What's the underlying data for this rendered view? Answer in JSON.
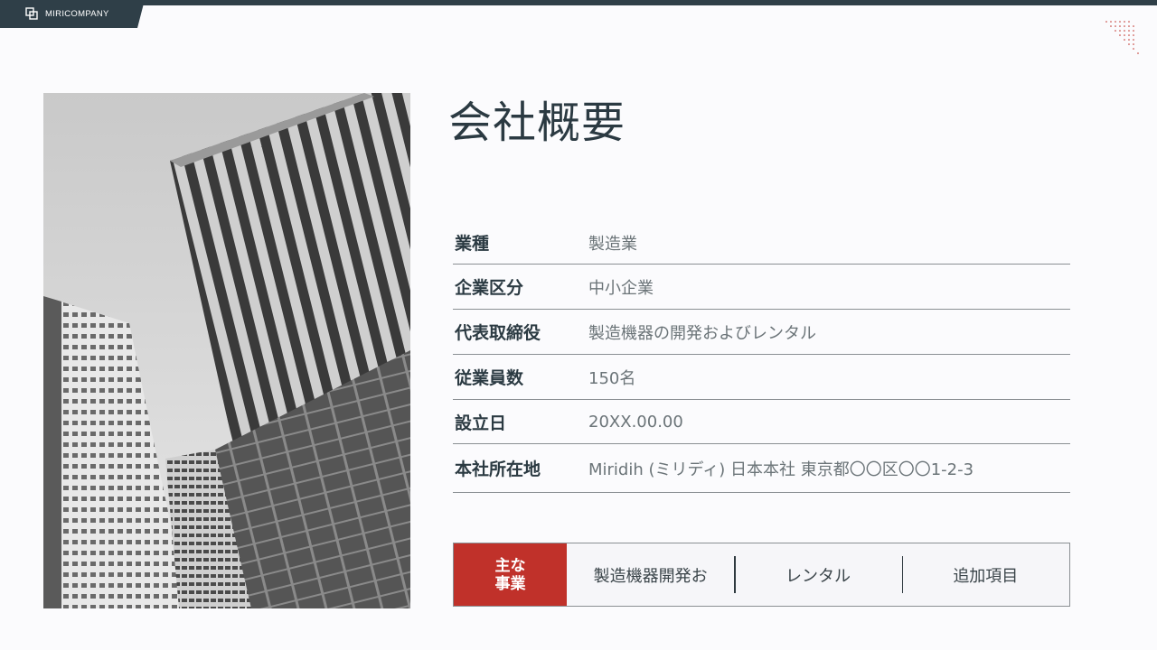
{
  "brand": {
    "name": "MIRICOMPANY"
  },
  "title": "会社概要",
  "info": [
    {
      "key": "業種",
      "value": "製造業"
    },
    {
      "key": "企業区分",
      "value": "中小企業"
    },
    {
      "key": "代表取締役",
      "value": "製造機器の開発およびレンタル"
    },
    {
      "key": "従業員数",
      "value": "150名"
    },
    {
      "key": "設立日",
      "value": "20XX.00.00"
    },
    {
      "key": "本社所在地",
      "value": "Miridih (ミリディ) 日本本社 東京都〇〇区〇〇1-2-3"
    }
  ],
  "business": {
    "label_line1": "主な",
    "label_line2": "事業",
    "items": [
      "製造機器開発お",
      "レンタル",
      "追加項目"
    ]
  },
  "colors": {
    "navy": "#2f3f48",
    "accent_red": "#c0312a"
  },
  "icons": {
    "logo": "overlapping-squares-logo-icon",
    "photo": "skyscrapers-photo"
  }
}
